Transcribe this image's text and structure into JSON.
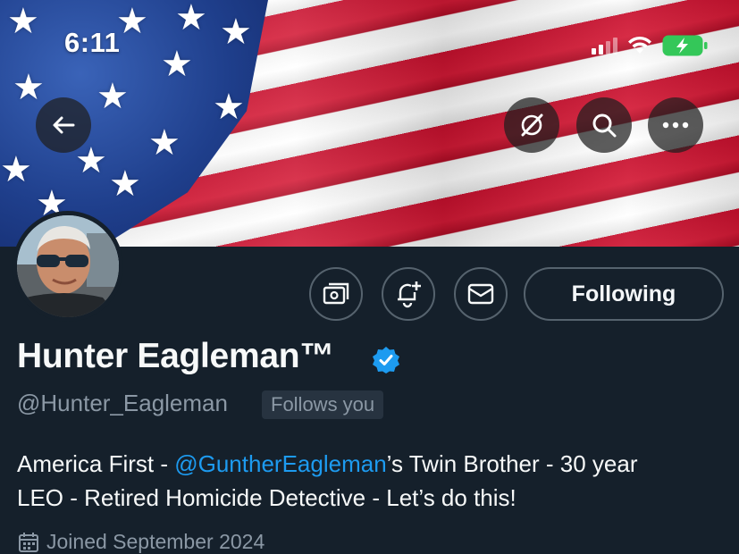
{
  "status_bar": {
    "time": "6:11"
  },
  "profile": {
    "name": "Hunter Eagleman™",
    "handle": "@Hunter_Eagleman",
    "follows_you": "Follows you",
    "bio": {
      "prefix": "America First - ",
      "mention": "@GuntherEagleman",
      "suffix_line1": "’s Twin Brother - 30 year",
      "line2": "LEO - Retired Homicide Detective - Let’s do this!"
    },
    "joined": "Joined September 2024"
  },
  "actions": {
    "following_label": "Following"
  },
  "icons": [
    "back-arrow-icon",
    "grok-icon",
    "search-icon",
    "more-icon",
    "tip-jar-icon",
    "notification-add-icon",
    "message-icon",
    "verified-badge-icon",
    "calendar-icon",
    "signal-icon",
    "wifi-icon",
    "battery-charging-icon"
  ],
  "colors": {
    "background": "#15202b",
    "accent": "#1d9bf0",
    "secondary_text": "#8b98a5",
    "battery": "#34c759"
  }
}
